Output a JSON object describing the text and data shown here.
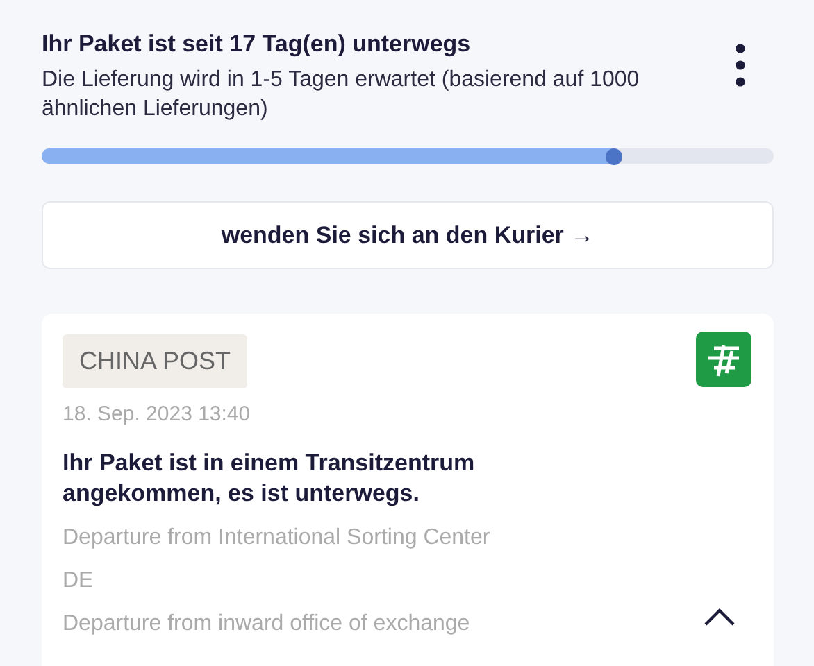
{
  "header": {
    "title": "Ihr Paket ist seit 17 Tag(en) unterwegs",
    "subtitle": "Die Lieferung wird in 1-5 Tagen erwartet (basierend auf 1000 ähnlichen Lieferungen)"
  },
  "progress": {
    "level": 0.79
  },
  "courier_button": {
    "label": "wenden Sie sich an den Kurier →"
  },
  "event": {
    "carrier": "CHINA POST",
    "timestamp": "18. Sep. 2023 13:40",
    "status": "Ihr Paket ist in einem Transitzentrum angekommen, es ist unterwegs.",
    "expanded": true,
    "details": [
      "Departure from International Sorting Center",
      "DE",
      "Departure from inward office of exchange"
    ]
  }
}
